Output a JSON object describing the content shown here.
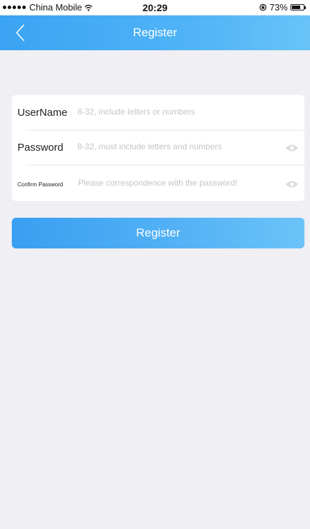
{
  "status_bar": {
    "carrier": "China Mobile",
    "time": "20:29",
    "battery_percent": "73%",
    "battery_level": 0.73
  },
  "nav": {
    "back_icon": "chevron-left-icon",
    "title": "Register"
  },
  "form": {
    "username": {
      "label": "UserName",
      "value": "",
      "placeholder": "8-32, include letters or numbers"
    },
    "password": {
      "label": "Password",
      "value": "",
      "placeholder": "8-32, must include letters and numbers",
      "toggle_icon": "eye-icon"
    },
    "confirm_password": {
      "label": "Confirm Password",
      "value": "",
      "placeholder": "Please correspondence with the password!",
      "toggle_icon": "eye-icon"
    }
  },
  "register_button": {
    "label": "Register"
  },
  "colors": {
    "header_gradient_start": "#3aa3f3",
    "header_gradient_end": "#69c3f8",
    "page_background": "#efeff4",
    "card_background": "#ffffff",
    "placeholder_text": "#c4c4c4",
    "button_gradient_start": "#3a9ff1",
    "button_gradient_end": "#6cc3f8"
  }
}
